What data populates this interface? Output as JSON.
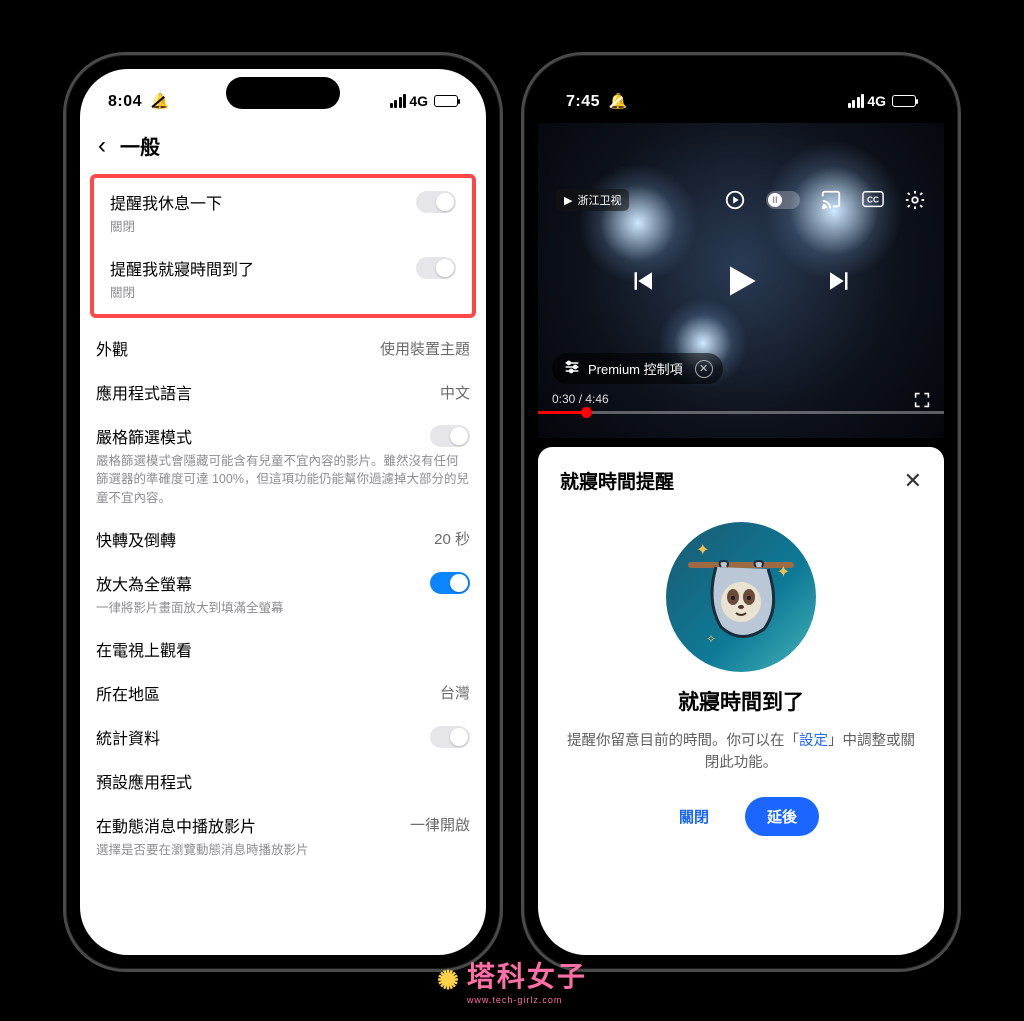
{
  "left": {
    "status": {
      "time": "8:04",
      "net": "4G"
    },
    "header": {
      "title": "一般"
    },
    "settings": [
      {
        "title": "提醒我休息一下",
        "sub": "關閉",
        "toggle": "off"
      },
      {
        "title": "提醒我就寢時間到了",
        "sub": "關閉",
        "toggle": "off"
      },
      {
        "title": "外觀",
        "val": "使用裝置主題"
      },
      {
        "title": "應用程式語言",
        "val": "中文"
      },
      {
        "title": "嚴格篩選模式",
        "toggle": "off",
        "sub": "嚴格篩選模式會隱藏可能含有兒童不宜內容的影片。雖然沒有任何篩選器的準確度可達 100%，但這項功能仍能幫你過濾掉大部分的兒童不宜內容。"
      },
      {
        "title": "快轉及倒轉",
        "val": "20 秒"
      },
      {
        "title": "放大為全螢幕",
        "toggle": "on",
        "sub": "一律將影片畫面放大到填滿全螢幕"
      },
      {
        "title": "在電視上觀看"
      },
      {
        "title": "所在地區",
        "val": "台灣"
      },
      {
        "title": "統計資料",
        "toggle": "off"
      },
      {
        "title": "預設應用程式"
      },
      {
        "title": "在動態消息中播放影片",
        "val": "一律開啟",
        "sub": "選擇是否要在瀏覽動態消息時播放影片"
      }
    ]
  },
  "right": {
    "status": {
      "time": "7:45",
      "net": "4G"
    },
    "player": {
      "channel_tag": "浙江卫视",
      "premium_label": "Premium 控制項",
      "elapsed": "0:30",
      "total": "4:46"
    },
    "sheet": {
      "header": "就寢時間提醒",
      "title": "就寢時間到了",
      "body_pre": "提醒你留意目前的時間。你可以在「",
      "body_link": "設定",
      "body_post": "」中調整或關閉此功能。",
      "btn_close": "關閉",
      "btn_snooze": "延後"
    }
  },
  "watermark": {
    "text": "塔科女子",
    "url": "www.tech-girlz.com"
  }
}
